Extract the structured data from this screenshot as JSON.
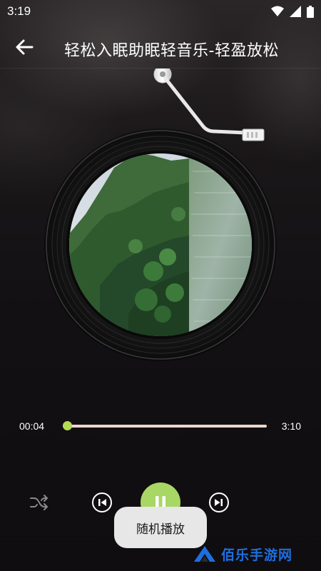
{
  "status_bar": {
    "time": "3:19",
    "icons": [
      "wifi-icon",
      "signal-icon",
      "battery-icon"
    ]
  },
  "header": {
    "back_icon": "back-arrow-icon",
    "title": "轻松入眠助眠轻音乐-轻盈放松"
  },
  "player": {
    "album_art": "landscape-mountain-lake",
    "current_time": "00:04",
    "total_time": "3:10",
    "progress": 0.021
  },
  "controls": {
    "shuffle_icon": "shuffle-icon",
    "prev_icon": "skip-previous-icon",
    "play_pause_icon": "pause-icon",
    "next_icon": "skip-next-icon"
  },
  "toast": {
    "text": "随机播放"
  },
  "watermark": {
    "text": "佰乐手游网"
  },
  "colors": {
    "accent": "#a8d765",
    "progress_track": "#ecd6cf",
    "toast_bg": "#e7e7e7",
    "watermark": "#1f6ee0"
  }
}
